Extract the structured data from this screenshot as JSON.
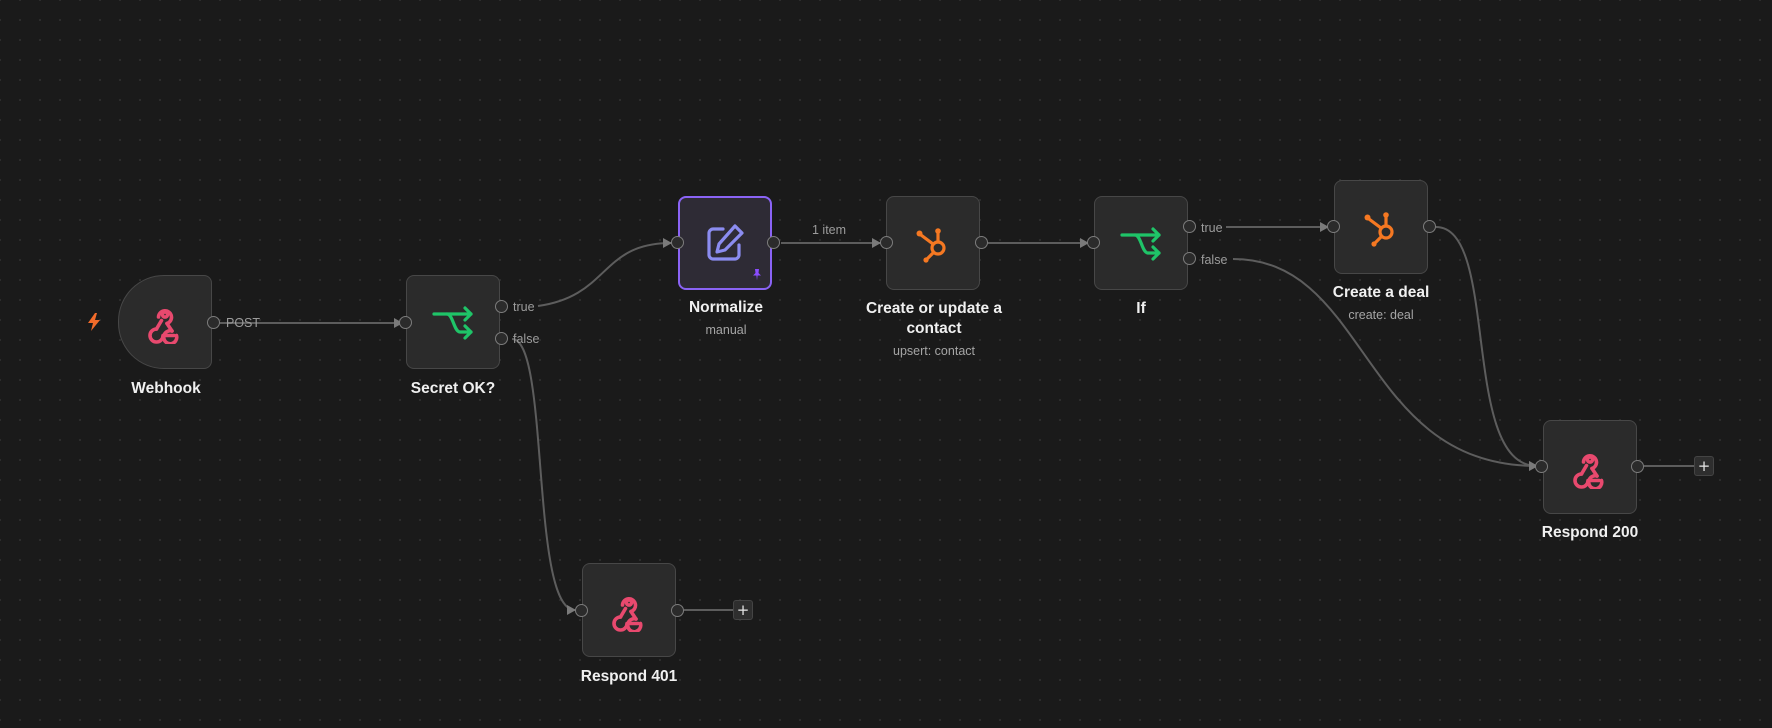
{
  "nodes": {
    "webhook": {
      "title": "Webhook",
      "output_label": "POST"
    },
    "secret_ok": {
      "title": "Secret OK?",
      "true_label": "true",
      "false_label": "false"
    },
    "normalize": {
      "title": "Normalize",
      "subtitle": "manual",
      "output_label": "1 item"
    },
    "create_update_contact": {
      "title_line1": "Create or update a",
      "title_line2": "contact",
      "subtitle": "upsert: contact"
    },
    "if_node": {
      "title": "If",
      "true_label": "true",
      "false_label": "false"
    },
    "create_deal": {
      "title": "Create a deal",
      "subtitle": "create: deal"
    },
    "respond_200": {
      "title": "Respond 200"
    },
    "respond_401": {
      "title": "Respond 401"
    }
  },
  "buttons": {
    "add_node": "+"
  },
  "icons": {
    "webhook": "webhook-icon",
    "condition": "branch-icon",
    "edit": "edit-icon",
    "hubspot": "hubspot-icon",
    "pin": "pin-icon",
    "trigger": "lightning-icon"
  },
  "colors": {
    "canvas": "#1a1a1a",
    "node": "#2b2b2b",
    "selected": "#8a63f5",
    "webhook": "#e8496e",
    "condition": "#1fc468",
    "hubspot": "#f57822",
    "edit": "#8b8cf0",
    "trigger": "#f26b2a"
  }
}
